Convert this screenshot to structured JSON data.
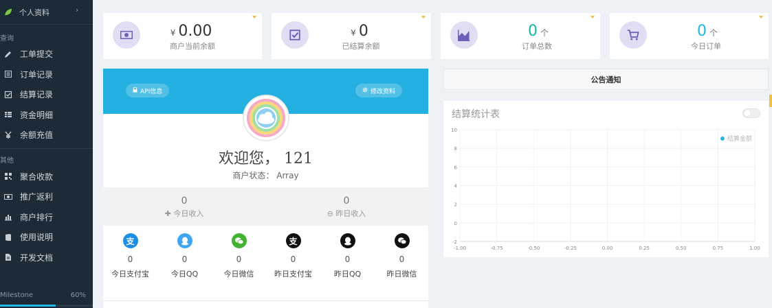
{
  "sidebar": {
    "top_item": "个人资料",
    "section_query": "查询",
    "query_items": [
      {
        "label": "工单提交",
        "icon": "pencil-icon"
      },
      {
        "label": "订单记录",
        "icon": "list-icon"
      },
      {
        "label": "结算记录",
        "icon": "check-square-icon"
      },
      {
        "label": "资金明细",
        "icon": "table-icon"
      },
      {
        "label": "余额充值",
        "icon": "yen-icon"
      }
    ],
    "section_other": "其他",
    "other_items": [
      {
        "label": "聚合收款",
        "icon": "qrcode-icon"
      },
      {
        "label": "推广返利",
        "icon": "money-icon"
      },
      {
        "label": "商户排行",
        "icon": "bar-chart-icon"
      },
      {
        "label": "使用说明",
        "icon": "book-icon"
      },
      {
        "label": "开发文档",
        "icon": "file-icon"
      }
    ],
    "milestone": {
      "label": "Milestone",
      "percent_text": "60%",
      "percent": 0.6
    }
  },
  "stats": [
    {
      "prefix": "¥",
      "value": "0.00",
      "unit": "",
      "label": "商户当前余额",
      "icon": "money-icon"
    },
    {
      "prefix": "¥",
      "value": "0",
      "unit": "",
      "label": "已结算余额",
      "icon": "check-square-icon"
    },
    {
      "prefix": "",
      "value": "0",
      "unit": "个",
      "label": "订单总数",
      "icon": "area-chart-icon"
    },
    {
      "prefix": "",
      "value": "0",
      "unit": "个",
      "label": "今日订单",
      "icon": "cart-icon"
    }
  ],
  "profile": {
    "api_button": "API信息",
    "edit_button": "修改资料",
    "welcome": "欢迎您， 121",
    "status_label": "商户状态：",
    "status_value": "Array",
    "today_income_value": "0",
    "today_income_label": "今日收入",
    "yesterday_income_value": "0",
    "yesterday_income_label": "昨日收入",
    "payments": [
      {
        "value": "0",
        "label": "今日支付宝",
        "icon": "alipay-icon",
        "color": "#1a8fe3",
        "glyph": "支"
      },
      {
        "value": "0",
        "label": "今日QQ",
        "icon": "qq-icon",
        "color": "#3fa7f2",
        "glyph": ""
      },
      {
        "value": "0",
        "label": "今日微信",
        "icon": "wechat-icon",
        "color": "#43b232",
        "glyph": ""
      },
      {
        "value": "0",
        "label": "昨日支付宝",
        "icon": "alipay-icon",
        "color": "#111111",
        "glyph": "支"
      },
      {
        "value": "0",
        "label": "昨日QQ",
        "icon": "qq-icon",
        "color": "#111111",
        "glyph": ""
      },
      {
        "value": "0",
        "label": "昨日微信",
        "icon": "wechat-icon",
        "color": "#111111",
        "glyph": ""
      }
    ]
  },
  "notice": {
    "title": "公告通知"
  },
  "chart_panel": {
    "title": "结算统计表"
  },
  "chart_data": {
    "type": "line",
    "title": "结算统计表",
    "series": [
      {
        "name": "结算金额",
        "values": []
      }
    ],
    "x_ticks": [
      "-1.00",
      "-0.75",
      "-0.50",
      "-0.25",
      "0.00",
      "0.25",
      "0.50",
      "0.75",
      "1.00"
    ],
    "y_ticks": [
      "10",
      "8",
      "6",
      "4",
      "2",
      "0",
      "-2"
    ],
    "xlim": [
      -1,
      1
    ],
    "ylim": [
      -2,
      10
    ],
    "grid": true,
    "legend": "top-right",
    "series_color": "#23b7e5"
  }
}
